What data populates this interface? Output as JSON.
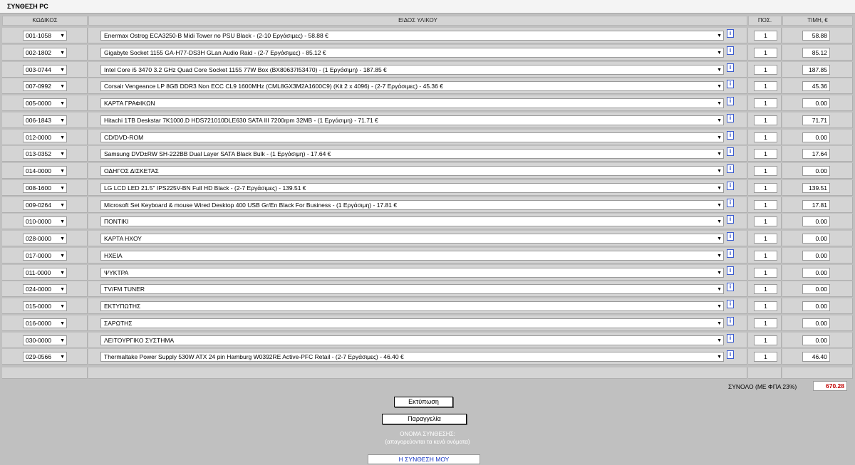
{
  "title": "ΣΥΝΘΕΣΗ PC",
  "headers": {
    "code": "ΚΩΔΙΚΟΣ",
    "item": "ΕΙΔΟΣ ΥΛΙΚΟΥ",
    "qty": "ΠΟΣ.",
    "price": "ΤΙΜΗ, €"
  },
  "icons": {
    "dropdown": "chevron-down-icon",
    "info": "info-icon"
  },
  "info_label": "i",
  "rows": [
    {
      "code": "001-1058",
      "item": "Enermax Ostrog ECA3250-B Midi Tower no PSU Black - (2-10 Εργάσιμες) - 58.88 €",
      "qty": "1",
      "price": "58.88"
    },
    {
      "code": "002-1802",
      "item": "Gigabyte Socket 1155 GA-H77-DS3H GLan Audio Raid - (2-7 Εργάσιμες) - 85.12 €",
      "qty": "1",
      "price": "85.12"
    },
    {
      "code": "003-0744",
      "item": "Intel Core i5 3470 3.2 GHz Quad Core Socket 1155 77W Box (BX80637I53470) - (1 Εργάσιμη) - 187.85 €",
      "qty": "1",
      "price": "187.85"
    },
    {
      "code": "007-0992",
      "item": "Corsair Vengeance LP 8GB DDR3 Non ECC CL9 1600MHz (CML8GX3M2A1600C9) (Kit 2 x 4096) - (2-7 Εργάσιμες) - 45.36 €",
      "qty": "1",
      "price": "45.36"
    },
    {
      "code": "005-0000",
      "item": "ΚΑΡΤΑ ΓΡΑΦΙΚΩΝ",
      "qty": "1",
      "price": "0.00"
    },
    {
      "code": "006-1843",
      "item": "Hitachi 1TB Deskstar 7K1000.D HDS721010DLE630 SATA III 7200rpm 32MB - (1 Εργάσιμη) - 71.71 €",
      "qty": "1",
      "price": "71.71"
    },
    {
      "code": "012-0000",
      "item": "CD/DVD-ROM",
      "qty": "1",
      "price": "0.00"
    },
    {
      "code": "013-0352",
      "item": "Samsung DVD±RW SH-222BB Dual Layer SATA Black Bulk - (1 Εργάσιμη) - 17.64 €",
      "qty": "1",
      "price": "17.64"
    },
    {
      "code": "014-0000",
      "item": "ΟΔΗΓΟΣ ΔΙΣΚΕΤΑΣ",
      "qty": "1",
      "price": "0.00"
    },
    {
      "code": "008-1600",
      "item": "LG LCD LED 21.5\" IPS225V-BN Full HD Black - (2-7 Εργάσιμες) - 139.51 €",
      "qty": "1",
      "price": "139.51"
    },
    {
      "code": "009-0264",
      "item": "Microsoft Set Keyboard & mouse Wired Desktop 400 USB Gr/En Black For Business - (1 Εργάσιμη) - 17.81 €",
      "qty": "1",
      "price": "17.81"
    },
    {
      "code": "010-0000",
      "item": "ΠΟΝΤΙΚΙ",
      "qty": "1",
      "price": "0.00"
    },
    {
      "code": "028-0000",
      "item": "ΚΑΡΤΑ ΗΧΟΥ",
      "qty": "1",
      "price": "0.00"
    },
    {
      "code": "017-0000",
      "item": "ΗΧΕΙΑ",
      "qty": "1",
      "price": "0.00"
    },
    {
      "code": "011-0000",
      "item": "ΨΥΚΤΡΑ",
      "qty": "1",
      "price": "0.00"
    },
    {
      "code": "024-0000",
      "item": "TV/FM TUNER",
      "qty": "1",
      "price": "0.00"
    },
    {
      "code": "015-0000",
      "item": "ΕΚΤΥΠΩΤΗΣ",
      "qty": "1",
      "price": "0.00"
    },
    {
      "code": "016-0000",
      "item": "ΣΑΡΩΤΗΣ",
      "qty": "1",
      "price": "0.00"
    },
    {
      "code": "030-0000",
      "item": "ΛΕΙΤΟΥΡΓΙΚΟ ΣΥΣΤΗΜΑ",
      "qty": "1",
      "price": "0.00"
    },
    {
      "code": "029-0566",
      "item": "Thermaltake Power Supply 530W ATX 24 pin Hamburg W0392RE Active-PFC Retail - (2-7 Εργάσιμες) - 46.40 €",
      "qty": "1",
      "price": "46.40"
    }
  ],
  "total": {
    "label": "ΣΥΝΟΛΟ (ΜΕ ΦΠΑ 23%)",
    "value": "670.28"
  },
  "buttons": {
    "print": "Εκτύπωση",
    "order": "Παραγγελία"
  },
  "build_name": {
    "label": "ΟΝΟΜΑ ΣΥΝΘΕΣΗΣ:",
    "note": "(απαγορεύονται τα κενά ονόματα)",
    "value": "Η ΣΥΝΘΕΣΗ ΜΟΥ"
  },
  "colors": {
    "background": "#c0c0c0",
    "total_value": "#c00000",
    "name_value": "#1030c0",
    "info_icon": "#1a3cc0"
  }
}
